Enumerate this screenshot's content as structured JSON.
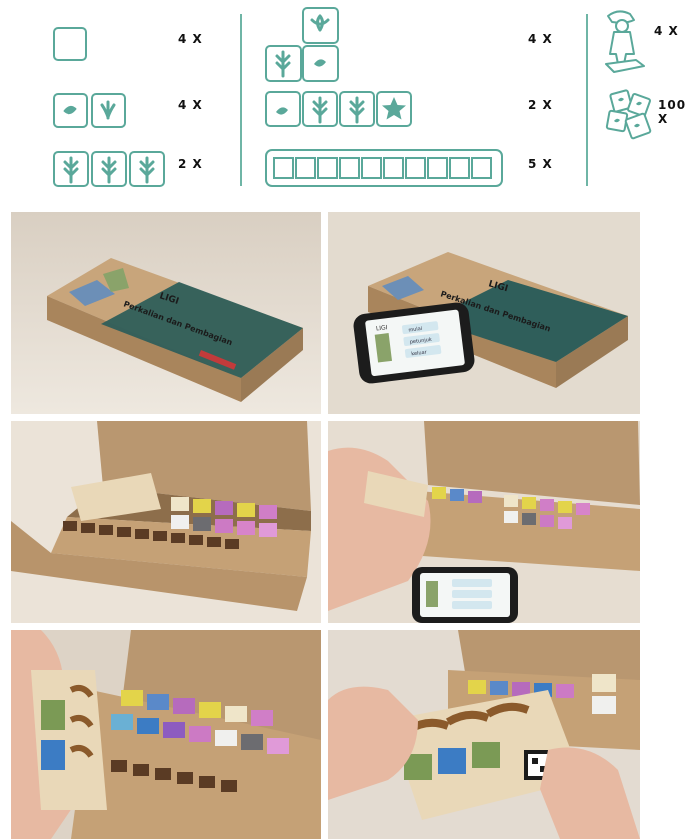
{
  "legend": {
    "left": {
      "items": [
        {
          "name": "empty-tile",
          "qty": "4 X"
        },
        {
          "name": "two-leaf-tiles",
          "qty": "4 X"
        },
        {
          "name": "three-wheat-tiles",
          "qty": "2 X"
        }
      ]
    },
    "middle": {
      "items": [
        {
          "name": "l-shaped-tiles",
          "qty": "4 X"
        },
        {
          "name": "four-tile-strip-with-star",
          "qty": "2 X"
        },
        {
          "name": "ten-slot-tray",
          "qty": "5 X"
        }
      ]
    },
    "right": {
      "items": [
        {
          "name": "farmer-pawn",
          "qty": "4 X"
        },
        {
          "name": "dice-pieces",
          "qty": "100 X"
        }
      ]
    }
  },
  "box_label": {
    "title": "LIGI",
    "subtitle": "Perkalian dan Pembagian"
  },
  "phone_app": {
    "title": "LIGI",
    "buttons": [
      "mulai",
      "petunjuk",
      "keluar"
    ]
  },
  "colors": {
    "accent": "#5aa89a",
    "cardboard": "#c9a479",
    "table": "#e8e0d4",
    "box_green": "#2f5e5a"
  }
}
